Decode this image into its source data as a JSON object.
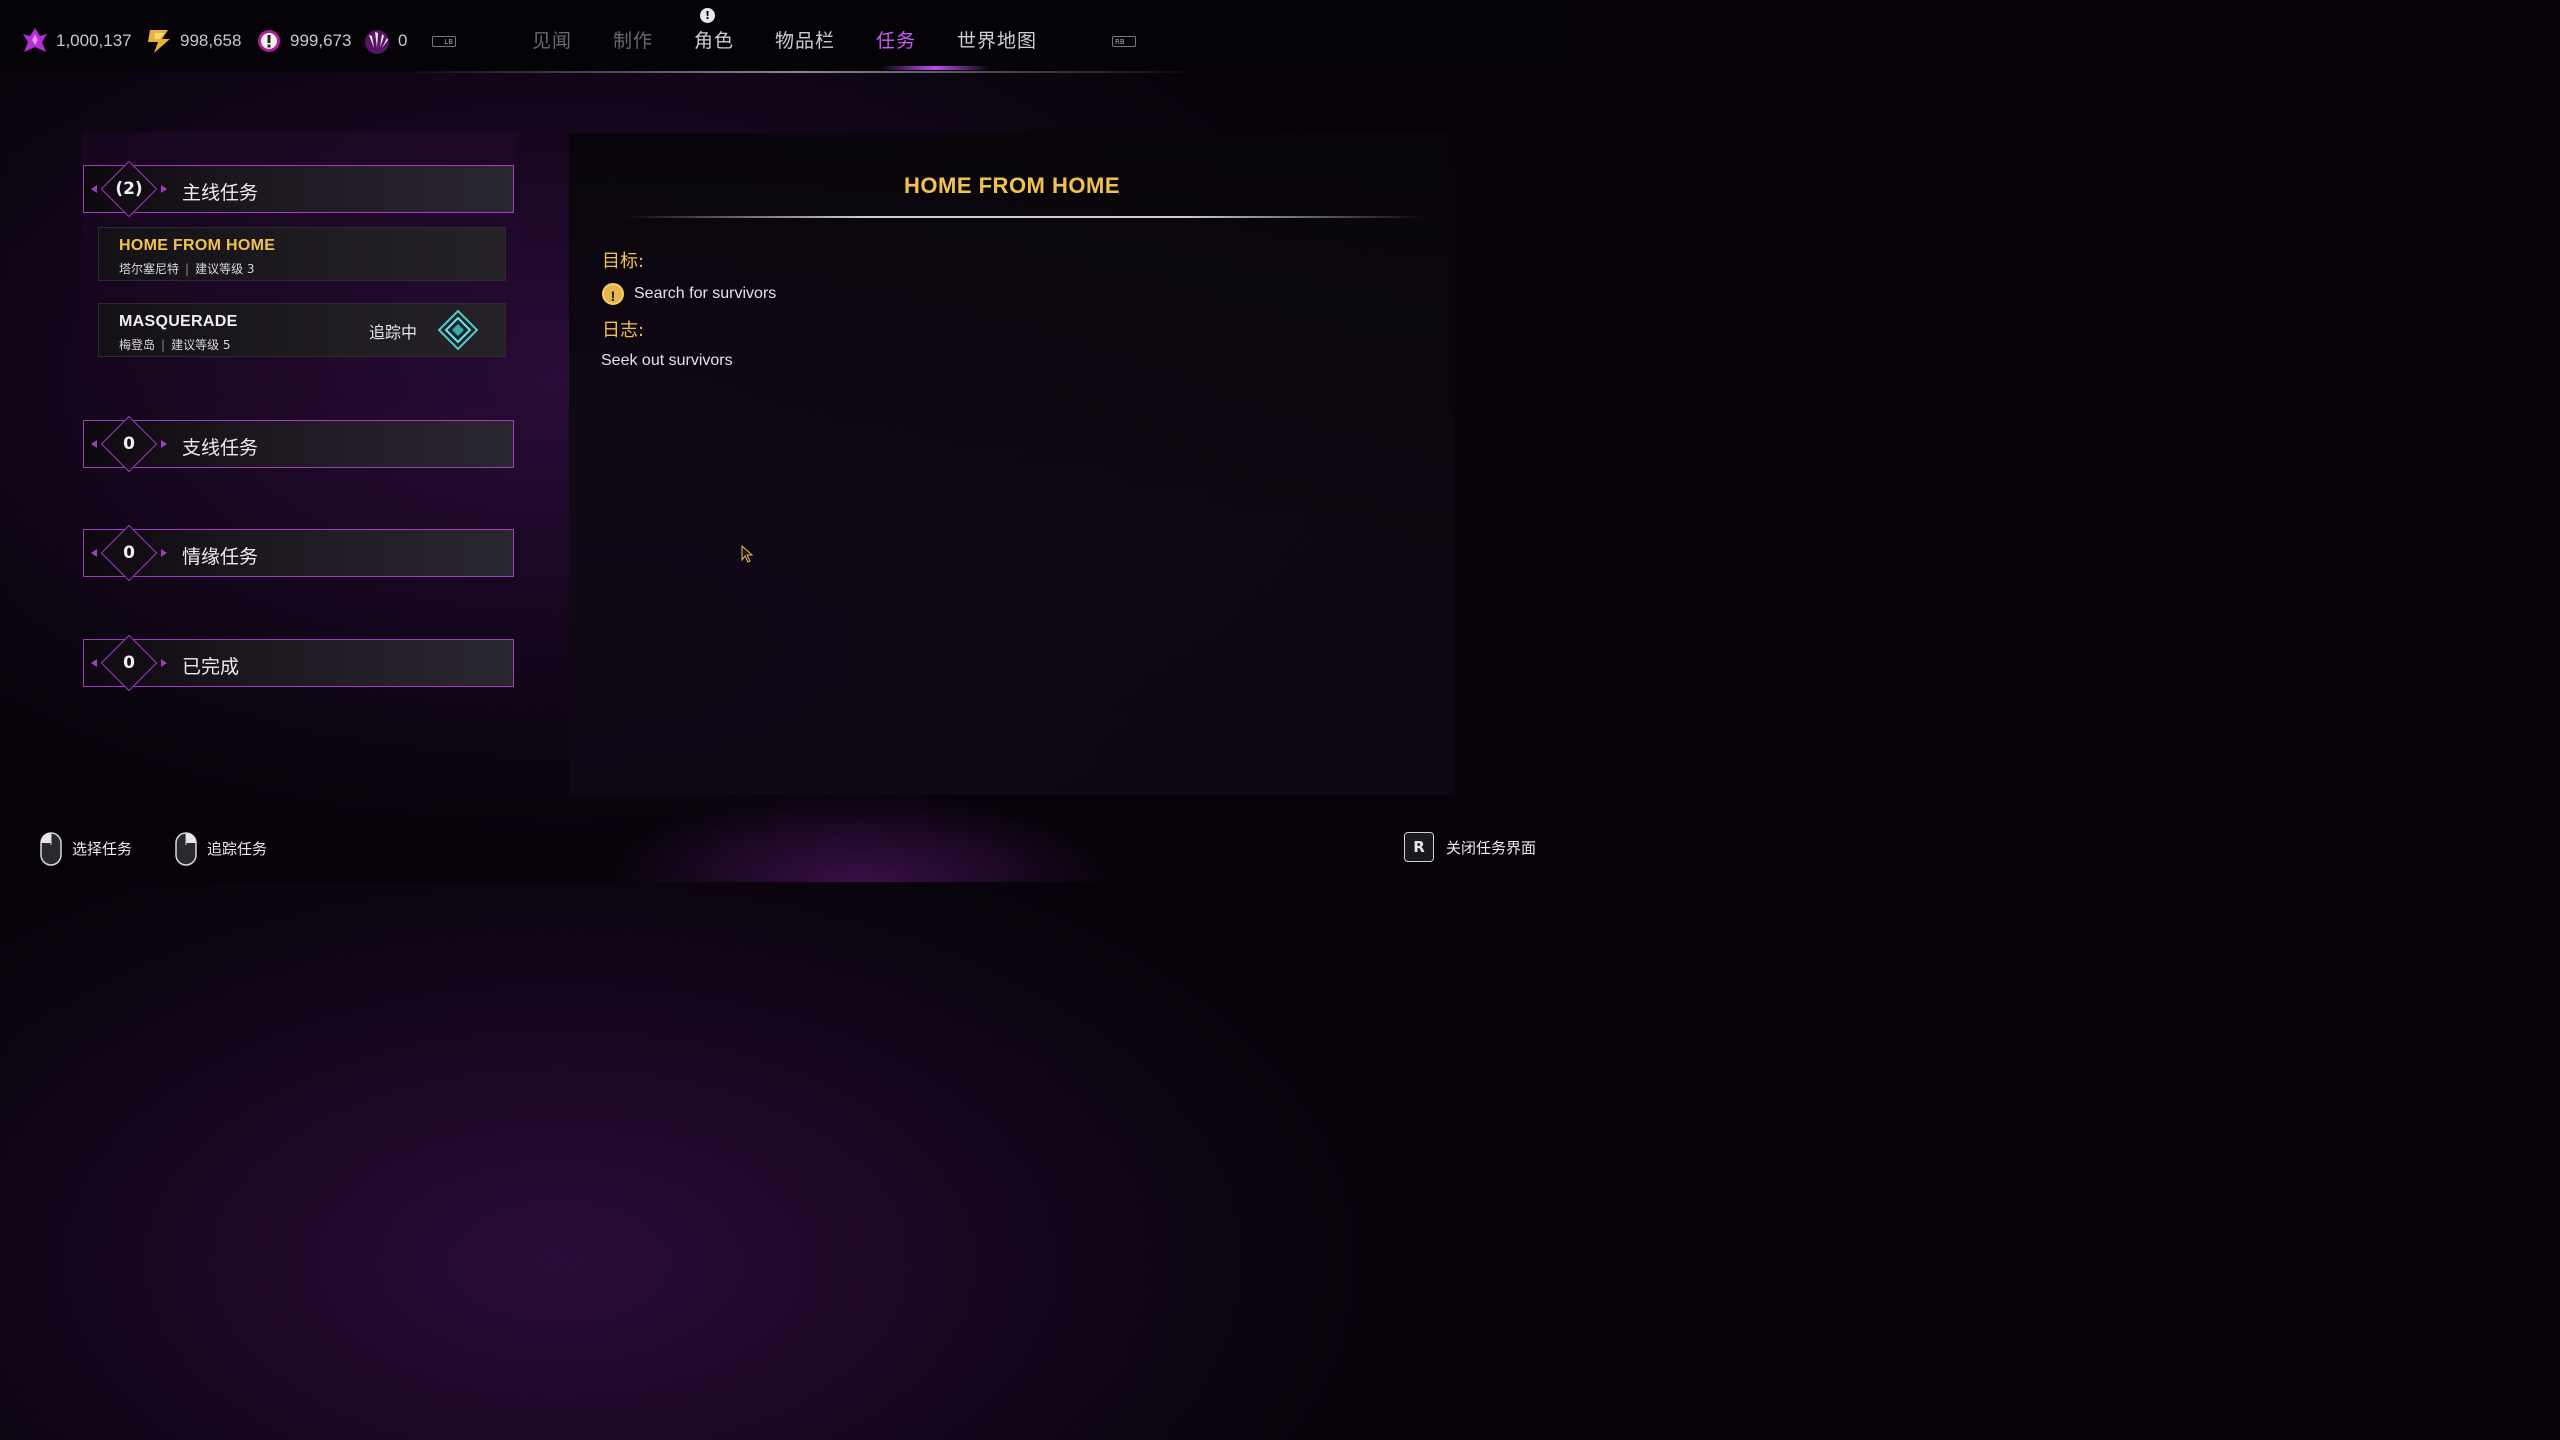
{
  "currencies": [
    {
      "icon": "purple-crystal-icon",
      "value": "1,000,137"
    },
    {
      "icon": "gold-lightning-icon",
      "value": "998,658"
    },
    {
      "icon": "alert-shield-icon",
      "value": "999,673"
    },
    {
      "icon": "white-claw-icon",
      "value": "0"
    }
  ],
  "nav": {
    "lb": "LB",
    "rb": "RB",
    "tabs": [
      "见闻",
      "制作",
      "角色",
      "物品栏",
      "任务",
      "世界地图"
    ],
    "active_tab": "任务",
    "alert": "!"
  },
  "categories": [
    {
      "count": "(2)",
      "label": "主线任务"
    },
    {
      "count": "0",
      "label": "支线任务"
    },
    {
      "count": "0",
      "label": "情缘任务"
    },
    {
      "count": "0",
      "label": "已完成"
    }
  ],
  "quests": [
    {
      "title": "HOME FROM HOME",
      "location": "塔尔塞尼特",
      "level": "建议等级 3",
      "tracking": ""
    },
    {
      "title": "MASQUERADE",
      "location": "梅登岛",
      "level": "建议等级 5",
      "tracking": "追踪中"
    }
  ],
  "detail": {
    "title": "HOME FROM HOME",
    "objective_heading": "目标:",
    "objective": "Search for survivors",
    "log_heading": "日志:",
    "log": "Seek out survivors"
  },
  "hints": [
    {
      "icon": "mouse-left-icon",
      "label": "选择任务"
    },
    {
      "icon": "mouse-right-icon",
      "label": "追踪任务"
    },
    {
      "key": "R",
      "label": "关闭任务界面"
    }
  ],
  "colors": {
    "accent": "#c85cf0",
    "gold": "#f2c24e",
    "border": "#a33bc2"
  }
}
